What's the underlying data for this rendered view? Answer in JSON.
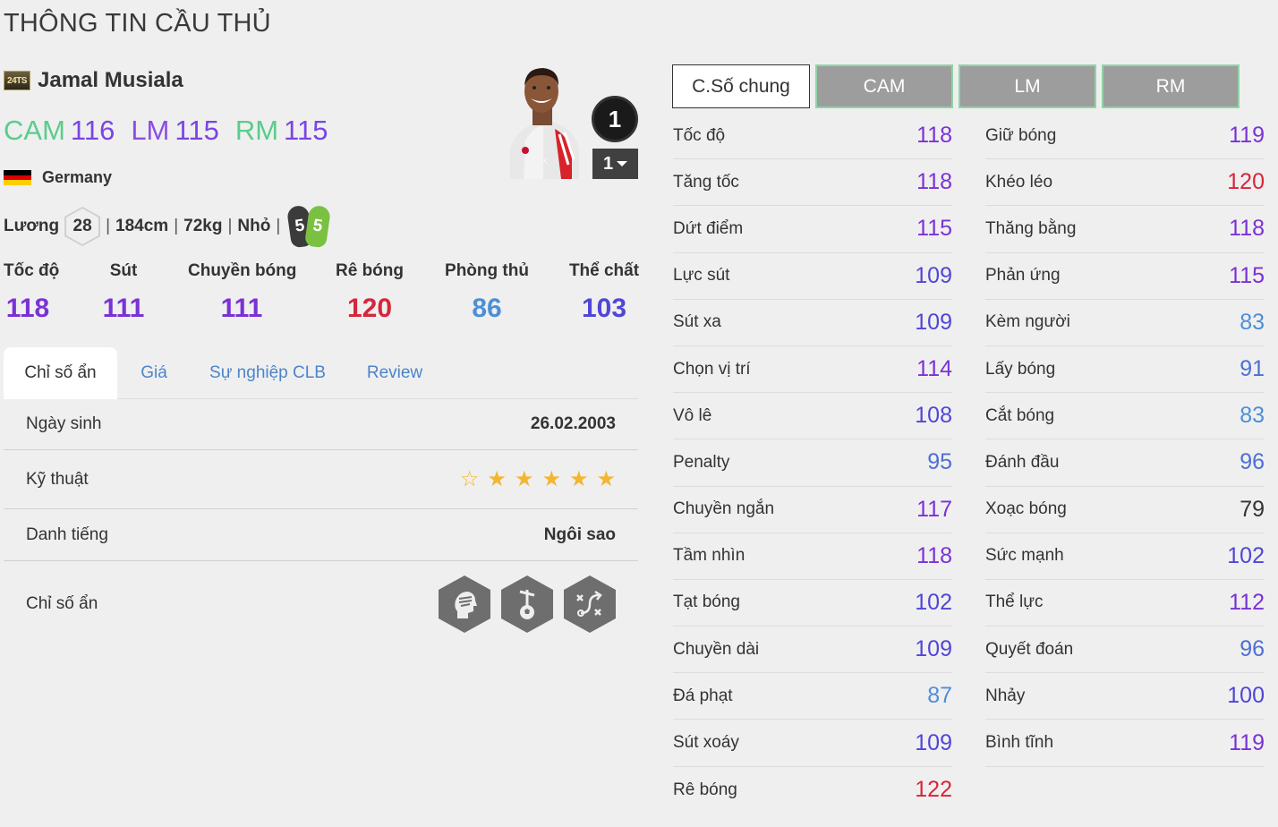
{
  "page_title": "THÔNG TIN CẦU THỦ",
  "player": {
    "season_badge": "24TS",
    "name": "Jamal Musiala",
    "positions": [
      {
        "name": "CAM",
        "value": "116",
        "color": "#5bcc8d"
      },
      {
        "name": "LM",
        "value": "115",
        "color": "#8e4ce6"
      },
      {
        "name": "RM",
        "value": "115",
        "color": "#5bcc8d"
      }
    ],
    "nation": "Germany",
    "salary_label": "Lương",
    "salary": "28",
    "height": "184cm",
    "weight": "72kg",
    "body_type": "Nhỏ",
    "left_foot": "5",
    "right_foot": "5",
    "rank": "1",
    "level": "1"
  },
  "main_stats": [
    {
      "label": "Tốc độ",
      "value": "118",
      "color": "#7a32d6"
    },
    {
      "label": "Sút",
      "value": "111",
      "color": "#7a32d6"
    },
    {
      "label": "Chuyền bóng",
      "value": "111",
      "color": "#7a32d6"
    },
    {
      "label": "Rê bóng",
      "value": "120",
      "color": "#d6263b"
    },
    {
      "label": "Phòng thủ",
      "value": "86",
      "color": "#4d8fd6"
    },
    {
      "label": "Thể chất",
      "value": "103",
      "color": "#5046d6"
    }
  ],
  "tabs": [
    "Chỉ số ẩn",
    "Giá",
    "Sự nghiệp CLB",
    "Review"
  ],
  "details": {
    "birth_label": "Ngày sinh",
    "birth_value": "26.02.2003",
    "skill_label": "Kỹ thuật",
    "skill_stars": 5,
    "reputation_label": "Danh tiếng",
    "reputation_value": "Ngôi sao",
    "hidden_label": "Chỉ số ẩn",
    "hidden_icons": [
      "head-traits-icon",
      "puppet-football-icon",
      "tactics-icon"
    ]
  },
  "position_tabs": [
    "C.Số chung",
    "CAM",
    "LM",
    "RM"
  ],
  "stats_left": [
    {
      "name": "Tốc độ",
      "value": "118",
      "color": "#7a32d6"
    },
    {
      "name": "Tăng tốc",
      "value": "118",
      "color": "#7a32d6"
    },
    {
      "name": "Dứt điểm",
      "value": "115",
      "color": "#7a32d6"
    },
    {
      "name": "Lực sút",
      "value": "109",
      "color": "#5046d6"
    },
    {
      "name": "Sút xa",
      "value": "109",
      "color": "#5046d6"
    },
    {
      "name": "Chọn vị trí",
      "value": "114",
      "color": "#7a32d6"
    },
    {
      "name": "Vô lê",
      "value": "108",
      "color": "#5046d6"
    },
    {
      "name": "Penalty",
      "value": "95",
      "color": "#4d6fd6"
    },
    {
      "name": "Chuyền ngắn",
      "value": "117",
      "color": "#7a32d6"
    },
    {
      "name": "Tầm nhìn",
      "value": "118",
      "color": "#7a32d6"
    },
    {
      "name": "Tạt bóng",
      "value": "102",
      "color": "#5046d6"
    },
    {
      "name": "Chuyền dài",
      "value": "109",
      "color": "#5046d6"
    },
    {
      "name": "Đá phạt",
      "value": "87",
      "color": "#4d8fd6"
    },
    {
      "name": "Sút xoáy",
      "value": "109",
      "color": "#5046d6"
    },
    {
      "name": "Rê bóng",
      "value": "122",
      "color": "#d6263b"
    }
  ],
  "stats_right": [
    {
      "name": "Giữ bóng",
      "value": "119",
      "color": "#7a32d6"
    },
    {
      "name": "Khéo léo",
      "value": "120",
      "color": "#d6263b"
    },
    {
      "name": "Thăng bằng",
      "value": "118",
      "color": "#7a32d6"
    },
    {
      "name": "Phản ứng",
      "value": "115",
      "color": "#7a32d6"
    },
    {
      "name": "Kèm người",
      "value": "83",
      "color": "#4d8fd6"
    },
    {
      "name": "Lấy bóng",
      "value": "91",
      "color": "#4d6fd6"
    },
    {
      "name": "Cắt bóng",
      "value": "83",
      "color": "#4d8fd6"
    },
    {
      "name": "Đánh đầu",
      "value": "96",
      "color": "#4d6fd6"
    },
    {
      "name": "Xoạc bóng",
      "value": "79",
      "color": "#333333"
    },
    {
      "name": "Sức mạnh",
      "value": "102",
      "color": "#5046d6"
    },
    {
      "name": "Thể lực",
      "value": "112",
      "color": "#7a32d6"
    },
    {
      "name": "Quyết đoán",
      "value": "96",
      "color": "#4d6fd6"
    },
    {
      "name": "Nhảy",
      "value": "100",
      "color": "#5046d6"
    },
    {
      "name": "Bình tĩnh",
      "value": "119",
      "color": "#7a32d6"
    }
  ]
}
